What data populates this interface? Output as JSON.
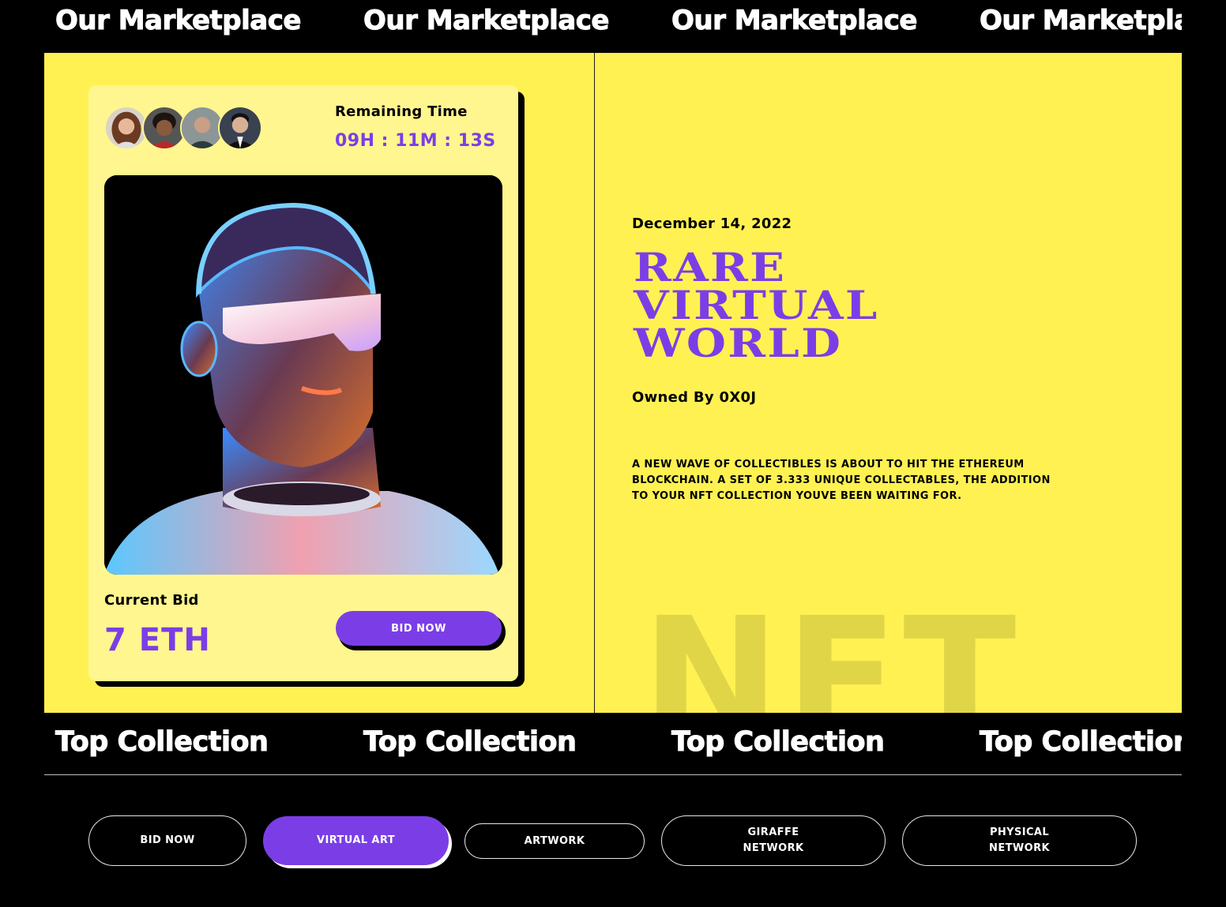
{
  "marquee_top": {
    "text": "Our Marketplace"
  },
  "marquee_bottom": {
    "text": "Top Collection"
  },
  "card": {
    "remaining_label": "Remaining Time",
    "remaining_value": "09H : 11M : 13S",
    "current_bid_label": "Current Bid",
    "current_bid_value": "7 ETH",
    "bid_button": "BID NOW"
  },
  "details": {
    "date": "December 14, 2022",
    "headline": "RARE VIRTUAL WORLD",
    "owner": "Owned By 0X0J",
    "description": "A NEW WAVE OF COLLECTIBLES IS ABOUT TO HIT THE ETHEREUM BLOCKCHAIN. A SET OF 3.333 UNIQUE COLLECTABLES, THE ADDITION TO YOUR NFT COLLECTION YOUVE BEEN WAITING FOR.",
    "watermark": "NFT"
  },
  "tabs": [
    {
      "label": "BID NOW",
      "active": false
    },
    {
      "label": "VIRTUAL ART",
      "active": true
    },
    {
      "label": "ARTWORK",
      "active": false
    },
    {
      "label": "GIRAFFE NETWORK",
      "active": false
    },
    {
      "label": "PHYSICAL NETWORK",
      "active": false
    }
  ],
  "colors": {
    "accent": "#7b3ee6",
    "hero_bg": "#fff152",
    "card_bg": "#fff68f",
    "page_bg": "#000000"
  }
}
